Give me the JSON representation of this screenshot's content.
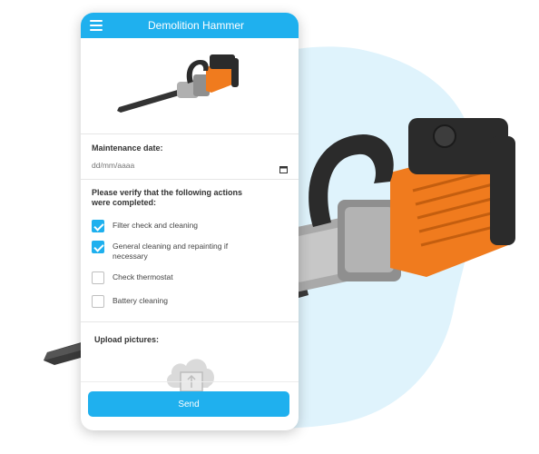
{
  "app": {
    "title": "Demolition Hammer"
  },
  "maintenance": {
    "label": "Maintenance date:",
    "date_placeholder": "dd/mm/aaaa"
  },
  "verification": {
    "heading_line1": "Please verify that the following actions",
    "heading_line2": "were completed:",
    "items": [
      {
        "label": "Filter check and cleaning",
        "checked": true
      },
      {
        "label_line1": "General cleaning and repainting if",
        "label_line2": "necessary",
        "checked": true
      },
      {
        "label": "Check thermostat",
        "checked": false
      },
      {
        "label": "Battery cleaning",
        "checked": false
      }
    ]
  },
  "upload": {
    "label": "Upload pictures:"
  },
  "actions": {
    "send_label": "Send"
  },
  "colors": {
    "accent": "#1fb0ee",
    "blob": "#dff3fc",
    "tool_orange": "#f07b1e",
    "tool_dark": "#2b2b2b"
  }
}
